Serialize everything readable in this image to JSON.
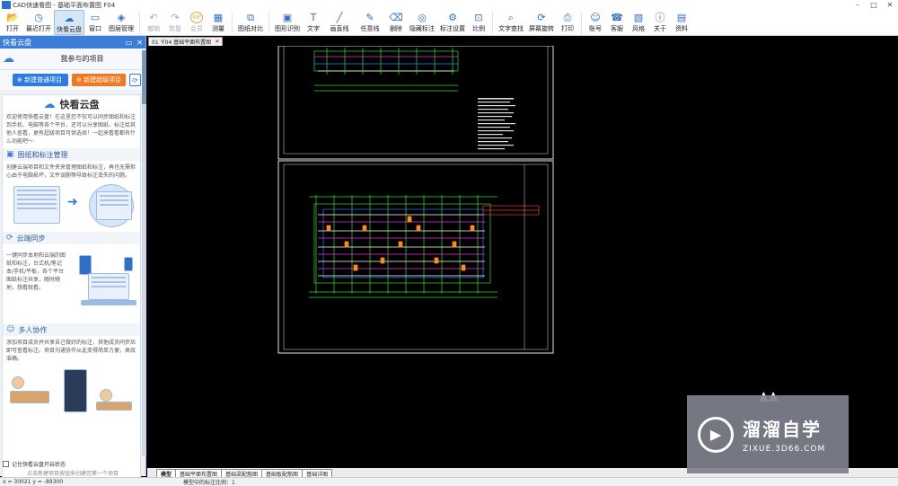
{
  "window": {
    "title": "CAD快速看图 - 基础平面布置图 F04",
    "controls": [
      "–",
      "□",
      "✕"
    ]
  },
  "toolbar": {
    "items": [
      {
        "label": "打开",
        "icon": "folder-icon",
        "glyph": "📂"
      },
      {
        "label": "最近打开",
        "icon": "clock-icon",
        "glyph": "◷"
      },
      {
        "label": "快看云盘",
        "icon": "cloud-icon",
        "glyph": "☁",
        "active": true
      },
      {
        "label": "窗口",
        "icon": "window-icon",
        "glyph": "▭"
      },
      {
        "label": "图层管理",
        "icon": "layers-icon",
        "glyph": "◈"
      },
      {
        "label": "撤销",
        "icon": "undo-icon",
        "glyph": "↶",
        "disabled": true
      },
      {
        "label": "恢复",
        "icon": "redo-icon",
        "glyph": "↷",
        "disabled": true
      },
      {
        "label": "会员",
        "icon": "vip-icon",
        "glyph": "VIP",
        "disabled": true
      },
      {
        "label": "测量",
        "icon": "measure-icon",
        "glyph": "▦"
      },
      {
        "label": "图纸对比",
        "icon": "compare-icon",
        "glyph": "⧉"
      },
      {
        "label": "图形识别",
        "icon": "recognize-icon",
        "glyph": "▣"
      },
      {
        "label": "文字",
        "icon": "text-icon",
        "glyph": "T"
      },
      {
        "label": "画直线",
        "icon": "line-icon",
        "glyph": "╱"
      },
      {
        "label": "任意线",
        "icon": "pencil-icon",
        "glyph": "✎"
      },
      {
        "label": "删除",
        "icon": "eraser-icon",
        "glyph": "⌫"
      },
      {
        "label": "隐藏标注",
        "icon": "hide-icon",
        "glyph": "◎"
      },
      {
        "label": "标注设置",
        "icon": "settings-icon",
        "glyph": "⚙"
      },
      {
        "label": "比例",
        "icon": "scale-icon",
        "glyph": "⊡"
      },
      {
        "label": "文字查找",
        "icon": "find-text-icon",
        "glyph": "⌕"
      },
      {
        "label": "屏幕旋转",
        "icon": "rotate-icon",
        "glyph": "⟳"
      },
      {
        "label": "打印",
        "icon": "print-icon",
        "glyph": "⎙"
      },
      {
        "label": "账号",
        "icon": "account-icon",
        "glyph": "☺"
      },
      {
        "label": "客服",
        "icon": "headset-icon",
        "glyph": "☎"
      },
      {
        "label": "风格",
        "icon": "style-icon",
        "glyph": "▧"
      },
      {
        "label": "关于",
        "icon": "info-icon",
        "glyph": "ⓘ"
      },
      {
        "label": "资料",
        "icon": "document-icon",
        "glyph": "▤"
      }
    ]
  },
  "panel": {
    "title": "快看云盘",
    "project_title": "我参与的项目",
    "new_normal": "新建普通项目",
    "new_super": "新建超级项目",
    "intro": {
      "heading": "快看云盘",
      "welcome": "欢迎使用快看云盘！在这里您不仅可以同步图纸和标注到手机、电脑等各个平台，还可以分享图纸、标注给其他人查看，更有超级项目可供选择！一起来看看都有什么功能吧～",
      "sec1_title": "图纸和标注管理",
      "sec1_text": "创建云端项目和文件夹来管理图纸和标注，再也无需担心由于电脑损坏，文件误删等导致标注丢失的问题。",
      "sec2_title": "云端同步",
      "sec2_text": "一键同步本地和云端的图纸和标注，台式机/笔记本/手机/平板，各个平台图纸标注共享，随时随地，想看就看。",
      "sec3_title": "多人协作",
      "sec3_text": "添加项目成员并共享自己做好的标注，其他成员同步后即可查看标注。项目沟通协作从此变得简单方便，高效准确。"
    },
    "remember": "记住快看云盘开启状态",
    "hint": "点击新建项目按钮来创建您第一个项目"
  },
  "document_tab": {
    "label": "01 'F04 基础平面布置图"
  },
  "sheet_tabs": [
    "模型",
    "基础平面布置图",
    "基础梁配筋图",
    "基础板配筋图",
    "基础详图"
  ],
  "status": {
    "coords": "x = 30021 y = -89300",
    "scale": "模型中的标注比例：1"
  },
  "watermark": {
    "name": "溜溜自学",
    "url": "ZIXUE.3D66.COM"
  }
}
